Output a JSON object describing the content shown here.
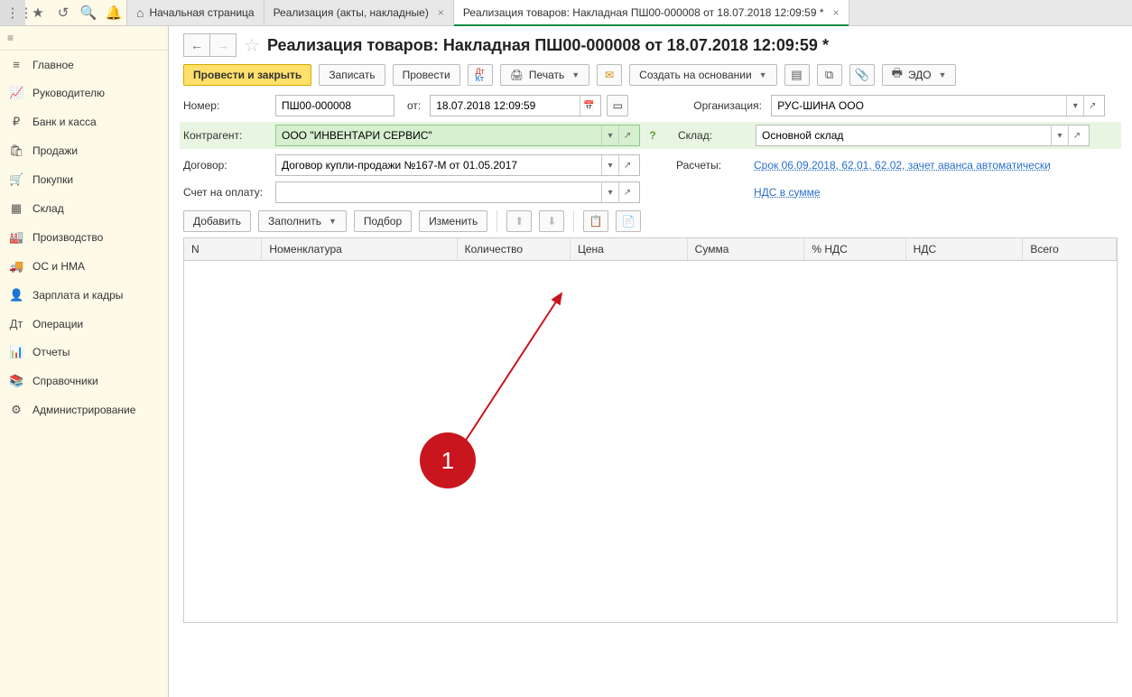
{
  "topbar": {
    "tabs": [
      {
        "label": "Начальная страница",
        "home": true
      },
      {
        "label": "Реализация (акты, накладные)",
        "closable": true
      },
      {
        "label": "Реализация товаров: Накладная ПШ00-000008 от 18.07.2018 12:09:59 *",
        "closable": true,
        "active": true
      }
    ]
  },
  "sidebar": {
    "items": [
      {
        "icon": "≡",
        "label": "Главное"
      },
      {
        "icon": "📈",
        "label": "Руководителю"
      },
      {
        "icon": "₽",
        "label": "Банк и касса"
      },
      {
        "icon": "🛍",
        "label": "Продажи"
      },
      {
        "icon": "🛒",
        "label": "Покупки"
      },
      {
        "icon": "▦",
        "label": "Склад"
      },
      {
        "icon": "🏭",
        "label": "Производство"
      },
      {
        "icon": "🚚",
        "label": "ОС и НМА"
      },
      {
        "icon": "👤",
        "label": "Зарплата и кадры"
      },
      {
        "icon": "Дт",
        "label": "Операции"
      },
      {
        "icon": "📊",
        "label": "Отчеты"
      },
      {
        "icon": "📚",
        "label": "Справочники"
      },
      {
        "icon": "⚙",
        "label": "Администрирование"
      }
    ]
  },
  "page": {
    "title": "Реализация товаров: Накладная ПШ00-000008 от 18.07.2018 12:09:59 *",
    "toolbar": {
      "post_close": "Провести и закрыть",
      "save": "Записать",
      "post": "Провести",
      "print": "Печать",
      "create_based": "Создать на основании",
      "edo": "ЭДО"
    },
    "form": {
      "number_label": "Номер:",
      "number": "ПШ00-000008",
      "from_label": "от:",
      "date": "18.07.2018 12:09:59",
      "org_label": "Организация:",
      "org": "РУС-ШИНА ООО",
      "contragent_label": "Контрагент:",
      "contragent": "ООО \"ИНВЕНТАРИ СЕРВИС\"",
      "sklad_label": "Склад:",
      "sklad": "Основной склад",
      "dogovor_label": "Договор:",
      "dogovor": "Договор купли-продажи №167-М от 01.05.2017",
      "raschety_label": "Расчеты:",
      "raschety": "Срок 06.09.2018, 62.01, 62.02, зачет аванса автоматически",
      "schet_label": "Счет на оплату:",
      "schet": "",
      "nds": "НДС в сумме"
    },
    "actions": {
      "add": "Добавить",
      "fill": "Заполнить",
      "pick": "Подбор",
      "change": "Изменить"
    },
    "table": {
      "cols": [
        "N",
        "Номенклатура",
        "Количество",
        "Цена",
        "Сумма",
        "% НДС",
        "НДС",
        "Всего"
      ],
      "widths": [
        80,
        230,
        125,
        130,
        130,
        110,
        130,
        100
      ]
    },
    "callout": "1"
  }
}
